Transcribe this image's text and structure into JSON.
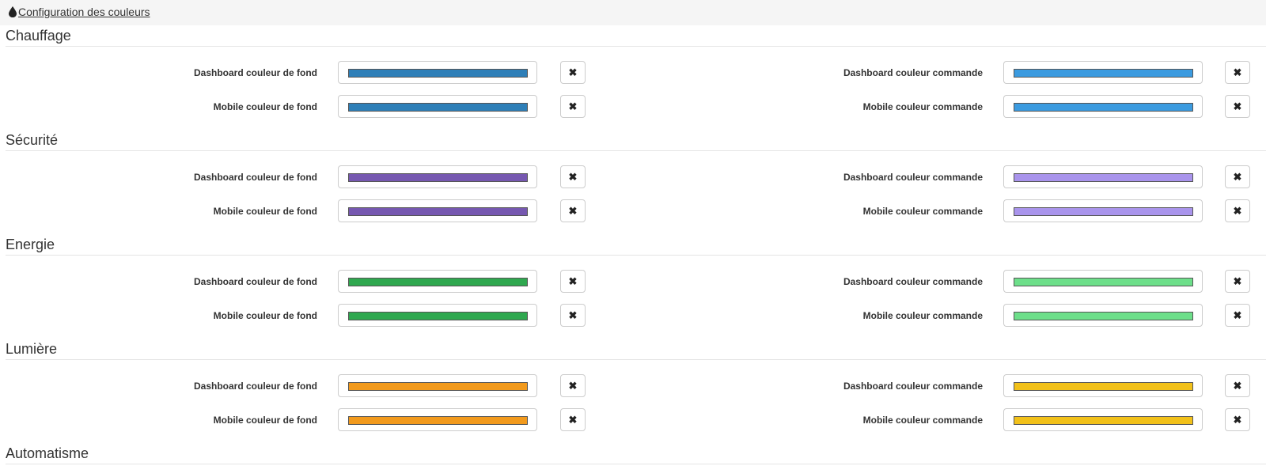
{
  "header": {
    "link_label": "Configuration des couleurs",
    "icon": "tint-drop-icon"
  },
  "icons": {
    "clear": "✖"
  },
  "labels": {
    "dashboard_fond": "Dashboard couleur de fond",
    "mobile_fond": "Mobile couleur de fond",
    "dashboard_commande": "Dashboard couleur commande",
    "mobile_commande": "Mobile couleur commande"
  },
  "sections": [
    {
      "title": "Chauffage",
      "colors": {
        "dashboard_fond": "#2e7fb8",
        "mobile_fond": "#2e7fb8",
        "dashboard_commande": "#3b9be0",
        "mobile_commande": "#3b9be0"
      }
    },
    {
      "title": "Sécurité",
      "colors": {
        "dashboard_fond": "#7658b0",
        "mobile_fond": "#7658b0",
        "dashboard_commande": "#a994ec",
        "mobile_commande": "#a994ec"
      }
    },
    {
      "title": "Energie",
      "colors": {
        "dashboard_fond": "#2fa84f",
        "mobile_fond": "#2fa84f",
        "dashboard_commande": "#6ddf8a",
        "mobile_commande": "#6ddf8a"
      }
    },
    {
      "title": "Lumière",
      "colors": {
        "dashboard_fond": "#f29a1d",
        "mobile_fond": "#f29a1d",
        "dashboard_commande": "#f2c11a",
        "mobile_commande": "#f2c11a"
      }
    },
    {
      "title": "Automatisme"
    }
  ]
}
